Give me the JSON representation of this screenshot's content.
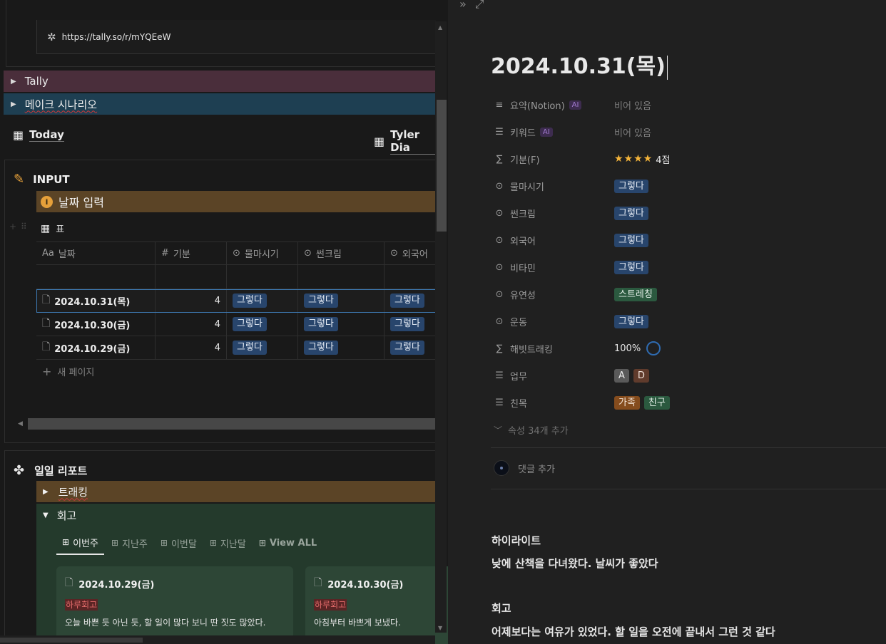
{
  "left": {
    "url": "https://tally.so/r/mYQEeW",
    "toggles": [
      {
        "label": "Tally"
      },
      {
        "label": "메이크 시나리오"
      }
    ],
    "views": [
      {
        "label": "Today"
      },
      {
        "label": "Tyler Dia"
      }
    ],
    "input": {
      "title": "INPUT",
      "callout": "날짜 입력",
      "table_label": "표",
      "columns": [
        "날짜",
        "기분",
        "물마시기",
        "썬크림",
        "외국어"
      ],
      "column_prefix": [
        "Aa",
        "#"
      ],
      "rows": [
        {
          "name": "2024.10.31(목)",
          "mood": "4",
          "water": "그렇다",
          "sunscreen": "그렇다",
          "lang": "그렇다"
        },
        {
          "name": "2024.10.30(금)",
          "mood": "4",
          "water": "그렇다",
          "sunscreen": "그렇다",
          "lang": "그렇다"
        },
        {
          "name": "2024.10.29(금)",
          "mood": "4",
          "water": "그렇다",
          "sunscreen": "그렇다",
          "lang": "그렇다"
        }
      ],
      "new_page": "새 페이지"
    },
    "report": {
      "title": "일일 리포트",
      "tracking": "트래킹",
      "retro": "회고",
      "tabs": [
        "이번주",
        "지난주",
        "이번달",
        "지난달",
        "View ALL"
      ],
      "cards": [
        {
          "title": "2024.10.29(금)",
          "tag": "하루회고",
          "text": "오늘 바쁜 듯 아닌 듯, 할 일이 많다 보니 딴 짓도 많았다."
        },
        {
          "title": "2024.10.30(금)",
          "tag": "하루회고",
          "text": "아침부터 바쁘게 보냈다."
        }
      ]
    }
  },
  "right": {
    "title": "2024.10.31(목)",
    "ai_badge": "AI",
    "props": [
      {
        "key": "요약(Notion)",
        "value": "비어 있음"
      },
      {
        "key": "키워드",
        "value": "비어 있음"
      },
      {
        "key": "기분(F)",
        "stars": "★★★★",
        "value": "4점"
      },
      {
        "key": "물마시기",
        "value": "그렇다"
      },
      {
        "key": "썬크림",
        "value": "그렇다"
      },
      {
        "key": "외국어",
        "value": "그렇다"
      },
      {
        "key": "비타민",
        "value": "그렇다"
      },
      {
        "key": "유연성",
        "value": "스트레칭"
      },
      {
        "key": "운동",
        "value": "그렇다"
      },
      {
        "key": "해빗트래킹",
        "value": "100%"
      },
      {
        "key": "업무",
        "tags": [
          "A",
          "D"
        ]
      },
      {
        "key": "친목",
        "tags": [
          "가족",
          "친구"
        ]
      }
    ],
    "more_props": "속성 34개 추가",
    "comment": "댓글 추가",
    "body": {
      "h1": "하이라이트",
      "p1": "낮에 산책을 다녀왔다. 날씨가 좋았다",
      "h2": "회고",
      "p2": "어제보다는 여유가 있었다. 할 일을 오전에 끝내서 그런 것 같다"
    }
  }
}
